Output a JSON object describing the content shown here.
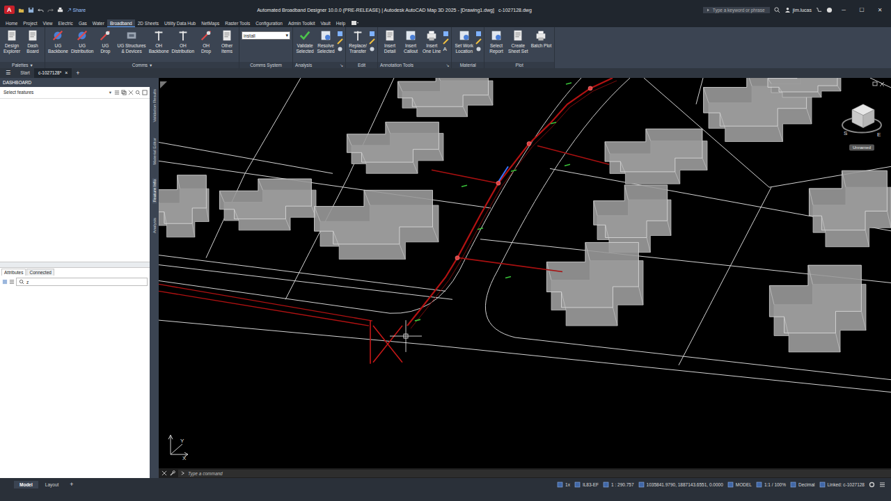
{
  "window": {
    "app_icon": "A",
    "title": "Automated Broadband Designer 10.0.0 (PRE-RELEASE) | Autodesk AutoCAD Map 3D 2025 - [Drawing1.dwg]",
    "document": "c-1027128.dwg",
    "share": "Share",
    "search_placeholder": "Type a keyword or phrase",
    "user": "jim.lucas",
    "controls": [
      "─",
      "☐",
      "✕"
    ]
  },
  "ribbon": {
    "tabs": [
      {
        "label": "Home",
        "selected": false
      },
      {
        "label": "Project",
        "selected": false
      },
      {
        "label": "View",
        "selected": false
      },
      {
        "label": "Electric",
        "selected": false
      },
      {
        "label": "Gas",
        "selected": false
      },
      {
        "label": "Water",
        "selected": false
      },
      {
        "label": "Broadband",
        "selected": true
      },
      {
        "label": "2D Sheets",
        "selected": false
      },
      {
        "label": "Utility Data Hub",
        "selected": false
      },
      {
        "label": "NetMaps",
        "selected": false
      },
      {
        "label": "Raster Tools",
        "selected": false
      },
      {
        "label": "Configuration",
        "selected": false
      },
      {
        "label": "Admin Toolkit",
        "selected": false
      },
      {
        "label": "Vault",
        "selected": false
      },
      {
        "label": "Help",
        "selected": false
      }
    ],
    "groups": [
      {
        "title": "Palettes",
        "caret": "▾",
        "items": [
          {
            "kind": "button",
            "lines": [
              "Design",
              "Explorer"
            ]
          },
          {
            "kind": "button",
            "lines": [
              "Dash",
              "Board"
            ]
          }
        ]
      },
      {
        "title": "Comms",
        "caret": "▾",
        "items": [
          {
            "kind": "button",
            "lines": [
              "UG",
              "Backbone"
            ]
          },
          {
            "kind": "button",
            "lines": [
              "UG",
              "Distribution"
            ]
          },
          {
            "kind": "button",
            "lines": [
              "UG",
              "Drop"
            ]
          },
          {
            "kind": "button",
            "lines": [
              "UG Structures",
              "& Devices"
            ]
          },
          {
            "kind": "button",
            "lines": [
              "OH",
              "Backbone"
            ]
          },
          {
            "kind": "button",
            "lines": [
              "OH",
              "Distribution"
            ]
          },
          {
            "kind": "button",
            "lines": [
              "OH",
              "Drop"
            ]
          },
          {
            "kind": "button",
            "lines": [
              "Other",
              "Items"
            ]
          }
        ]
      },
      {
        "title": "Comms System",
        "items": [
          {
            "kind": "dropdown",
            "value": "install",
            "caret": "▾"
          }
        ]
      },
      {
        "title": "Analysis",
        "launcher": "↘",
        "items": [
          {
            "kind": "button",
            "lines": [
              "Validate",
              "Selected"
            ]
          },
          {
            "kind": "button",
            "lines": [
              "Resolve",
              "Selected"
            ]
          },
          {
            "kind": "tools"
          }
        ]
      },
      {
        "title": "Edit",
        "items": [
          {
            "kind": "button",
            "lines": [
              "Replace/",
              "Transfer"
            ]
          },
          {
            "kind": "tools"
          }
        ]
      },
      {
        "title": "Annotation Tools",
        "launcher": "↘",
        "items": [
          {
            "kind": "button",
            "lines": [
              "Insert",
              "Detail"
            ]
          },
          {
            "kind": "button",
            "lines": [
              "Insert",
              "Callout"
            ]
          },
          {
            "kind": "button",
            "lines": [
              "Insert",
              "One Line"
            ]
          },
          {
            "kind": "tools",
            "glyph": "A"
          }
        ]
      },
      {
        "title": "Material",
        "items": [
          {
            "kind": "button",
            "lines": [
              "Set Work",
              "Location"
            ]
          },
          {
            "kind": "tools"
          }
        ]
      },
      {
        "title": "Plot",
        "items": [
          {
            "kind": "button",
            "lines": [
              "Select",
              "Report"
            ]
          },
          {
            "kind": "button",
            "lines": [
              "Create",
              "Sheet Set"
            ]
          },
          {
            "kind": "button",
            "lines": [
              "Batch Plot"
            ]
          }
        ]
      }
    ]
  },
  "file_tabs": {
    "menu": "☰",
    "tabs": [
      {
        "label": "Start",
        "selected": false,
        "closable": false
      },
      {
        "label": "c-1027128*",
        "selected": true,
        "closable": true
      }
    ],
    "close": "×",
    "add": "+"
  },
  "palette": {
    "title": "DASHBOARD",
    "selector": "Select features",
    "side_tabs": [
      {
        "label": "Validation Results",
        "selected": false
      },
      {
        "label": "Material Editor",
        "selected": false
      },
      {
        "label": "Feature Info",
        "selected": true
      },
      {
        "label": "Analysis",
        "selected": false
      }
    ],
    "bottom_tabs": [
      {
        "label": "Attributes",
        "selected": true
      },
      {
        "label": "Connected",
        "selected": false
      }
    ],
    "search_value": "z"
  },
  "canvas": {
    "viewcube": {
      "compass": [
        "S",
        "E"
      ],
      "view_name": "Unnamed"
    },
    "ucs": {
      "axes": [
        "Y",
        "X"
      ]
    }
  },
  "command_line": {
    "placeholder": "Type a command"
  },
  "status_bar": {
    "layout_tabs": [
      {
        "label": "Model",
        "selected": true
      },
      {
        "label": "Layout",
        "selected": false
      }
    ],
    "add": "+",
    "items": [
      "1x",
      "IL83-EF",
      "1 : 290.757",
      "1035841.9790, 1887143.6551, 0.0000",
      "MODEL",
      "1:1 / 100%",
      "Decimal",
      "Linked: c-1027128"
    ]
  }
}
